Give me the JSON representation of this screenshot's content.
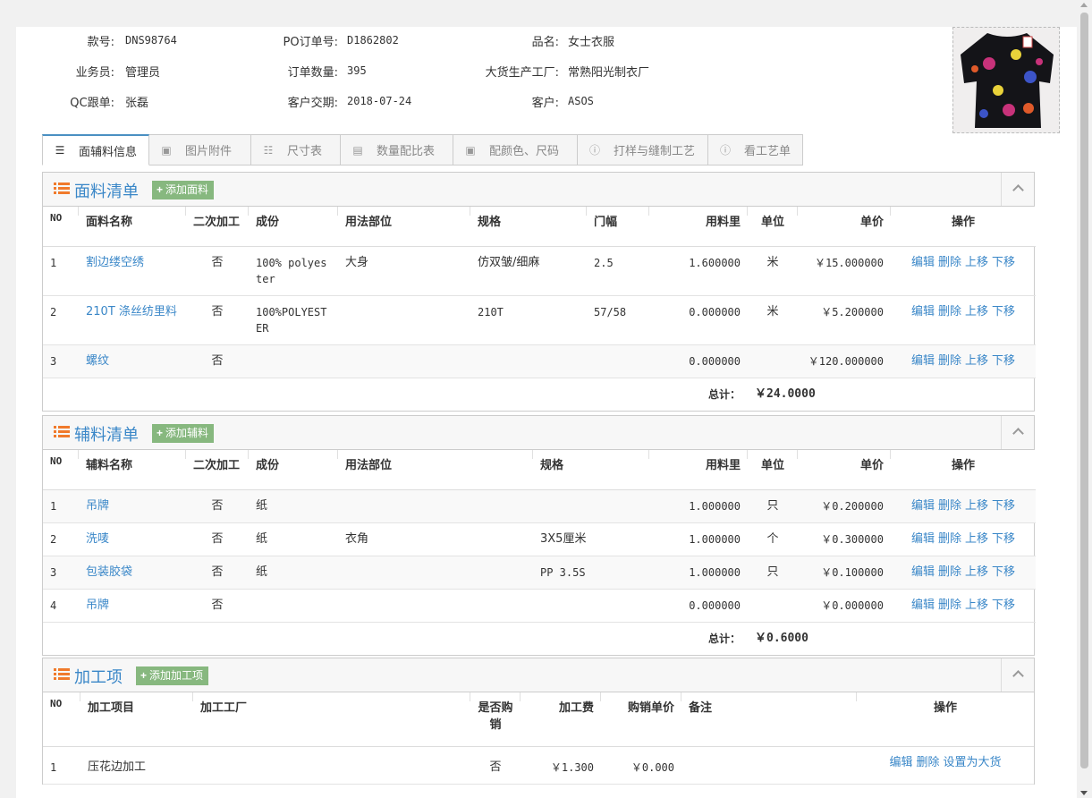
{
  "info": {
    "style_no_label": "款号:",
    "style_no": "DNS98764",
    "po_label": "PO订单号:",
    "po": "D1862802",
    "product_label": "品名:",
    "product": "女士衣服",
    "salesman_label": "业务员:",
    "salesman": "管理员",
    "qty_label": "订单数量:",
    "qty": "395",
    "factory_label": "大货生产工厂:",
    "factory": "常熟阳光制衣厂",
    "qc_label": "QC跟单:",
    "qc": "张磊",
    "delivery_label": "客户交期:",
    "delivery": "2018-07-24",
    "customer_label": "客户:",
    "customer": "ASOS"
  },
  "tabs": [
    {
      "label": "面辅料信息",
      "icon": "list-icon",
      "active": true
    },
    {
      "label": "图片附件",
      "icon": "image-icon"
    },
    {
      "label": "尺寸表",
      "icon": "list-icon"
    },
    {
      "label": "数量配比表",
      "icon": "table-icon"
    },
    {
      "label": "配颜色、尺码",
      "icon": "image-icon"
    },
    {
      "label": "打样与缝制工艺",
      "icon": "info-icon"
    },
    {
      "label": "看工艺单",
      "icon": "info-icon"
    }
  ],
  "fabric": {
    "title": "面料清单",
    "add_label": "添加面料",
    "headers": [
      "NO",
      "面料名称",
      "二次加工",
      "成份",
      "用法部位",
      "规格",
      "门幅",
      "用料里",
      "单位",
      "单价",
      "操作"
    ],
    "rows": [
      {
        "no": "1",
        "name": "割边缕空绣",
        "secondary": "否",
        "composition": "100% polyester",
        "usage": "大身",
        "spec": "仿双皱/细麻",
        "width": "2.5",
        "amount": "1.600000",
        "unit": "米",
        "price": "￥15.000000"
      },
      {
        "no": "2",
        "name": "210T 涤丝纺里料",
        "secondary": "否",
        "composition": "100%POLYESTER",
        "usage": "",
        "spec": "210T",
        "width": "57/58",
        "amount": "0.000000",
        "unit": "米",
        "price": "￥5.200000"
      },
      {
        "no": "3",
        "name": "螺纹",
        "secondary": "否",
        "composition": "",
        "usage": "",
        "spec": "",
        "width": "",
        "amount": "0.000000",
        "unit": "",
        "price": "￥120.000000"
      }
    ],
    "total_label": "总计：",
    "total": "￥24.0000"
  },
  "ops": {
    "edit": "编辑",
    "delete": "删除",
    "up": "上移",
    "down": "下移",
    "set_bulk": "设置为大货"
  },
  "accessory": {
    "title": "辅料清单",
    "add_label": "添加辅料",
    "headers": [
      "NO",
      "辅料名称",
      "二次加工",
      "成份",
      "用法部位",
      "规格",
      "用料里",
      "单位",
      "单价",
      "操作"
    ],
    "rows": [
      {
        "no": "1",
        "name": "吊牌",
        "secondary": "否",
        "composition": "纸",
        "usage": "",
        "spec": "",
        "amount": "1.000000",
        "unit": "只",
        "price": "￥0.200000"
      },
      {
        "no": "2",
        "name": "洗唛",
        "secondary": "否",
        "composition": "纸",
        "usage": "衣角",
        "spec": "3X5厘米",
        "amount": "1.000000",
        "unit": "个",
        "price": "￥0.300000"
      },
      {
        "no": "3",
        "name": "包装胶袋",
        "secondary": "否",
        "composition": "纸",
        "usage": "",
        "spec": "PP 3.5S",
        "amount": "1.000000",
        "unit": "只",
        "price": "￥0.100000"
      },
      {
        "no": "4",
        "name": "吊牌",
        "secondary": "否",
        "composition": "",
        "usage": "",
        "spec": "",
        "amount": "0.000000",
        "unit": "",
        "price": "￥0.000000"
      }
    ],
    "total_label": "总计：",
    "total": "￥0.6000"
  },
  "process": {
    "title": "加工项",
    "add_label": "添加加工项",
    "headers": [
      "NO",
      "加工项目",
      "加工工厂",
      "是否购销",
      "加工费",
      "购销单价",
      "备注",
      "操作"
    ],
    "rows": [
      {
        "no": "1",
        "item": "压花边加工",
        "factory": "",
        "purchase": "否",
        "fee": "￥1.300",
        "unit_price": "￥0.000",
        "remark": ""
      }
    ]
  },
  "colors": {
    "accent": "#3a87c8",
    "add_button": "#87b87f",
    "list_icon": "#f07a2b"
  }
}
